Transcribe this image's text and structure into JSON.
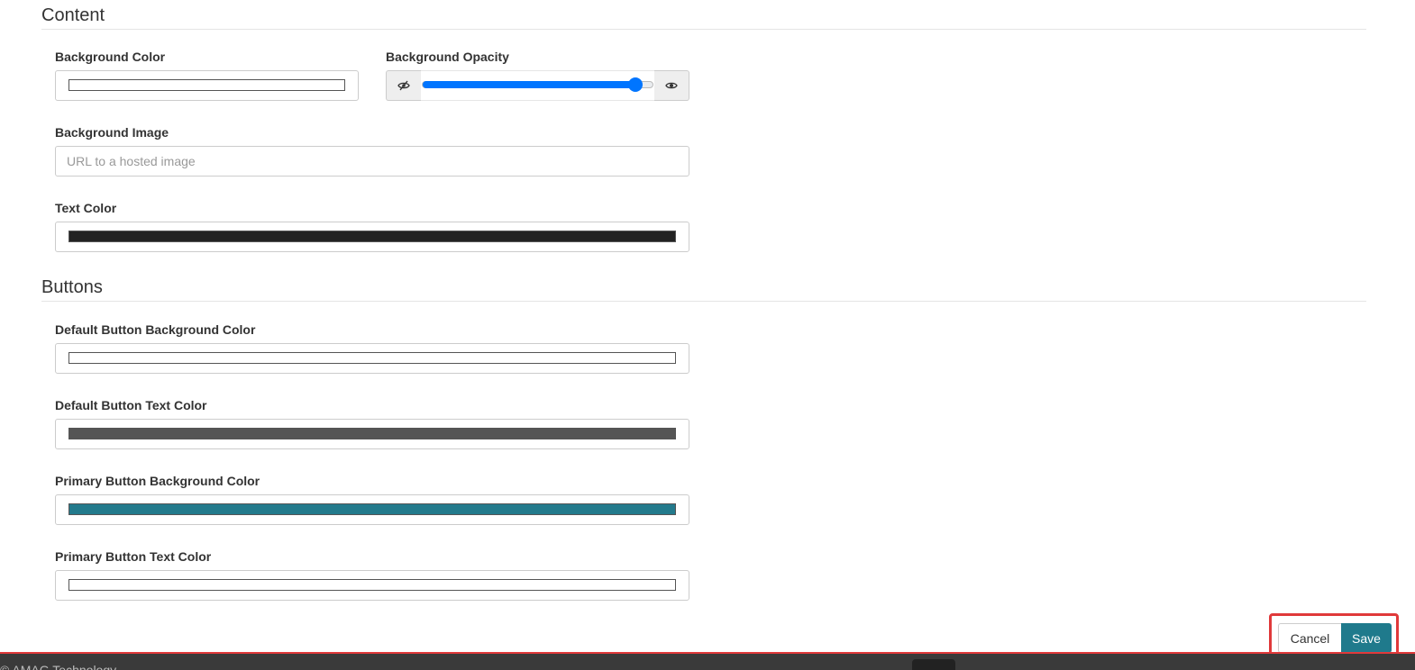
{
  "content": {
    "title": "Content",
    "background_color_label": "Background Color",
    "background_color_value": "#ffffff",
    "background_opacity_label": "Background Opacity",
    "background_opacity_value": 0.92,
    "background_image_label": "Background Image",
    "background_image_placeholder": "URL to a hosted image",
    "text_color_label": "Text Color",
    "text_color_value": "#222222"
  },
  "buttons": {
    "title": "Buttons",
    "default_bg_label": "Default Button Background Color",
    "default_bg_value": "#ffffff",
    "default_text_label": "Default Button Text Color",
    "default_text_value": "#555555",
    "primary_bg_label": "Primary Button Background Color",
    "primary_bg_value": "#237a8c",
    "primary_text_label": "Primary Button Text Color",
    "primary_text_value": "#ffffff"
  },
  "actions": {
    "cancel_label": "Cancel",
    "save_label": "Save",
    "save_color": "#1f7a8c",
    "highlight_color": "#e0393a"
  },
  "footer": {
    "text": "© AMAG Technology"
  }
}
